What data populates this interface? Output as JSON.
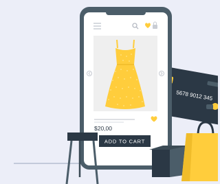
{
  "card": {
    "number_fragment": "5678 9012 345"
  },
  "product": {
    "price": "$20,00",
    "add_to_cart_label": "ADD TO CART"
  },
  "colors": {
    "background": "#eceef8",
    "phone_frame": "#4b5d69",
    "accent_yellow": "#ffcd3c",
    "dark_navy": "#2b3845",
    "image_bg": "#efefef"
  },
  "icons": {
    "menu": "hamburger-menu-icon",
    "search": "search-icon",
    "wishlist": "heart-icon",
    "bag": "shopping-bag-icon",
    "prev": "chevron-left-icon",
    "next": "chevron-right-icon"
  }
}
